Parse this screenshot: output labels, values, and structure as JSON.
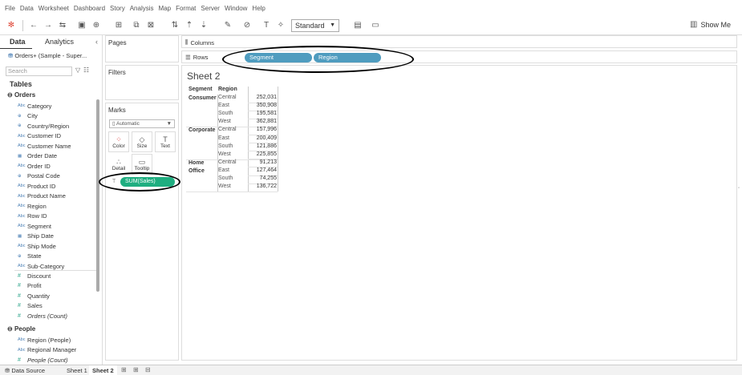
{
  "menu": [
    "File",
    "Data",
    "Worksheet",
    "Dashboard",
    "Story",
    "Analysis",
    "Map",
    "Format",
    "Server",
    "Window",
    "Help"
  ],
  "toolbar": {
    "fit_value": "Standard",
    "show_me_label": "Show Me"
  },
  "data_pane": {
    "tab_data": "Data",
    "tab_analytics": "Analytics",
    "datasource": "Orders+ (Sample - Super...",
    "search_placeholder": "Search",
    "tables_heading": "Tables",
    "orders_group": "Orders",
    "orders_fields": [
      {
        "name": "Category",
        "type": "Abc"
      },
      {
        "name": "City",
        "type": "geo"
      },
      {
        "name": "Country/Region",
        "type": "geo"
      },
      {
        "name": "Customer ID",
        "type": "Abc"
      },
      {
        "name": "Customer Name",
        "type": "Abc"
      },
      {
        "name": "Order Date",
        "type": "date"
      },
      {
        "name": "Order ID",
        "type": "Abc"
      },
      {
        "name": "Postal Code",
        "type": "geo"
      },
      {
        "name": "Product ID",
        "type": "Abc"
      },
      {
        "name": "Product Name",
        "type": "Abc"
      },
      {
        "name": "Region",
        "type": "Abc"
      },
      {
        "name": "Row ID",
        "type": "Abc"
      },
      {
        "name": "Segment",
        "type": "Abc"
      },
      {
        "name": "Ship Date",
        "type": "date"
      },
      {
        "name": "Ship Mode",
        "type": "Abc"
      },
      {
        "name": "State",
        "type": "geo"
      },
      {
        "name": "Sub-Category",
        "type": "Abc"
      }
    ],
    "orders_measures": [
      {
        "name": "Discount"
      },
      {
        "name": "Profit"
      },
      {
        "name": "Quantity"
      },
      {
        "name": "Sales"
      },
      {
        "name": "Orders (Count)",
        "italic": true
      }
    ],
    "people_group": "People",
    "people_fields": [
      {
        "name": "Region (People)",
        "type": "Abc"
      },
      {
        "name": "Regional Manager",
        "type": "Abc"
      },
      {
        "name": "People (Count)",
        "type": "m",
        "italic": true
      }
    ]
  },
  "cards": {
    "pages": "Pages",
    "filters": "Filters",
    "marks": "Marks",
    "mark_type": "Automatic",
    "marks_buttons": [
      "Color",
      "Size",
      "Text",
      "Detail",
      "Tooltip"
    ],
    "marks_pill": "SUM(Sales)"
  },
  "shelves": {
    "columns_label": "Columns",
    "rows_label": "Rows",
    "rows_pills": [
      "Segment",
      "Region"
    ]
  },
  "view": {
    "sheet_title": "Sheet 2",
    "header_segment": "Segment",
    "header_region": "Region",
    "segments": [
      {
        "label": "Consumer",
        "rows": [
          {
            "region": "Central",
            "value": "252,031"
          },
          {
            "region": "East",
            "value": "350,908"
          },
          {
            "region": "South",
            "value": "195,581"
          },
          {
            "region": "West",
            "value": "362,881"
          }
        ]
      },
      {
        "label": "Corporate",
        "rows": [
          {
            "region": "Central",
            "value": "157,996"
          },
          {
            "region": "East",
            "value": "200,409"
          },
          {
            "region": "South",
            "value": "121,886"
          },
          {
            "region": "West",
            "value": "225,855"
          }
        ]
      },
      {
        "label": "Home\nOffice",
        "rows": [
          {
            "region": "Central",
            "value": "91,213"
          },
          {
            "region": "East",
            "value": "127,464"
          },
          {
            "region": "South",
            "value": "74,255"
          },
          {
            "region": "West",
            "value": "136,722"
          }
        ]
      }
    ]
  },
  "bottom_tabs": {
    "datasource": "Data Source",
    "sheet1": "Sheet 1",
    "sheet2": "Sheet 2"
  },
  "colors": {
    "dimension_pill": "#4f9cbf",
    "measure_pill": "#1fae80"
  }
}
